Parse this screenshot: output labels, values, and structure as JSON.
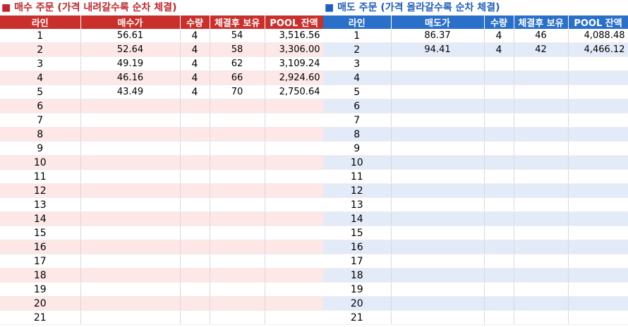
{
  "buy": {
    "title": "■ 매수 주문 (가격 내려갈수록 순차 체결)",
    "headers": [
      "라인",
      "매수가",
      "수량",
      "체결후 보유",
      "POOL 잔액"
    ],
    "rows": [
      {
        "line": "1",
        "price": "56.61",
        "qty": "4",
        "hold": "54",
        "pool": "3,516.56"
      },
      {
        "line": "2",
        "price": "52.64",
        "qty": "4",
        "hold": "58",
        "pool": "3,306.00"
      },
      {
        "line": "3",
        "price": "49.19",
        "qty": "4",
        "hold": "62",
        "pool": "3,109.24"
      },
      {
        "line": "4",
        "price": "46.16",
        "qty": "4",
        "hold": "66",
        "pool": "2,924.60"
      },
      {
        "line": "5",
        "price": "43.49",
        "qty": "4",
        "hold": "70",
        "pool": "2,750.64"
      },
      {
        "line": "6",
        "price": "",
        "qty": "",
        "hold": "",
        "pool": ""
      },
      {
        "line": "7",
        "price": "",
        "qty": "",
        "hold": "",
        "pool": ""
      },
      {
        "line": "8",
        "price": "",
        "qty": "",
        "hold": "",
        "pool": ""
      },
      {
        "line": "9",
        "price": "",
        "qty": "",
        "hold": "",
        "pool": ""
      },
      {
        "line": "10",
        "price": "",
        "qty": "",
        "hold": "",
        "pool": ""
      },
      {
        "line": "11",
        "price": "",
        "qty": "",
        "hold": "",
        "pool": ""
      },
      {
        "line": "12",
        "price": "",
        "qty": "",
        "hold": "",
        "pool": ""
      },
      {
        "line": "13",
        "price": "",
        "qty": "",
        "hold": "",
        "pool": ""
      },
      {
        "line": "14",
        "price": "",
        "qty": "",
        "hold": "",
        "pool": ""
      },
      {
        "line": "15",
        "price": "",
        "qty": "",
        "hold": "",
        "pool": ""
      },
      {
        "line": "16",
        "price": "",
        "qty": "",
        "hold": "",
        "pool": ""
      },
      {
        "line": "17",
        "price": "",
        "qty": "",
        "hold": "",
        "pool": ""
      },
      {
        "line": "18",
        "price": "",
        "qty": "",
        "hold": "",
        "pool": ""
      },
      {
        "line": "19",
        "price": "",
        "qty": "",
        "hold": "",
        "pool": ""
      },
      {
        "line": "20",
        "price": "",
        "qty": "",
        "hold": "",
        "pool": ""
      },
      {
        "line": "21",
        "price": "",
        "qty": "",
        "hold": "",
        "pool": ""
      }
    ]
  },
  "sell": {
    "title": "■ 매도 주문 (가격 올라갈수록 순차 체결)",
    "headers": [
      "라인",
      "매도가",
      "수량",
      "체결후 보유",
      "POOL 잔액"
    ],
    "rows": [
      {
        "line": "1",
        "price": "86.37",
        "qty": "4",
        "hold": "46",
        "pool": "4,088.48"
      },
      {
        "line": "2",
        "price": "94.41",
        "qty": "4",
        "hold": "42",
        "pool": "4,466.12"
      },
      {
        "line": "3",
        "price": "",
        "qty": "",
        "hold": "",
        "pool": ""
      },
      {
        "line": "4",
        "price": "",
        "qty": "",
        "hold": "",
        "pool": ""
      },
      {
        "line": "5",
        "price": "",
        "qty": "",
        "hold": "",
        "pool": ""
      },
      {
        "line": "6",
        "price": "",
        "qty": "",
        "hold": "",
        "pool": ""
      },
      {
        "line": "7",
        "price": "",
        "qty": "",
        "hold": "",
        "pool": ""
      },
      {
        "line": "8",
        "price": "",
        "qty": "",
        "hold": "",
        "pool": ""
      },
      {
        "line": "9",
        "price": "",
        "qty": "",
        "hold": "",
        "pool": ""
      },
      {
        "line": "10",
        "price": "",
        "qty": "",
        "hold": "",
        "pool": ""
      },
      {
        "line": "11",
        "price": "",
        "qty": "",
        "hold": "",
        "pool": ""
      },
      {
        "line": "12",
        "price": "",
        "qty": "",
        "hold": "",
        "pool": ""
      },
      {
        "line": "13",
        "price": "",
        "qty": "",
        "hold": "",
        "pool": ""
      },
      {
        "line": "14",
        "price": "",
        "qty": "",
        "hold": "",
        "pool": ""
      },
      {
        "line": "15",
        "price": "",
        "qty": "",
        "hold": "",
        "pool": ""
      },
      {
        "line": "16",
        "price": "",
        "qty": "",
        "hold": "",
        "pool": ""
      },
      {
        "line": "17",
        "price": "",
        "qty": "",
        "hold": "",
        "pool": ""
      },
      {
        "line": "18",
        "price": "",
        "qty": "",
        "hold": "",
        "pool": ""
      },
      {
        "line": "19",
        "price": "",
        "qty": "",
        "hold": "",
        "pool": ""
      },
      {
        "line": "20",
        "price": "",
        "qty": "",
        "hold": "",
        "pool": ""
      },
      {
        "line": "21",
        "price": "",
        "qty": "",
        "hold": "",
        "pool": ""
      }
    ]
  },
  "colors": {
    "buy_accent": "#c9302c",
    "buy_alt_row": "#fde7e7",
    "sell_accent": "#2a6fc9",
    "sell_alt_row": "#e3ebf8"
  }
}
